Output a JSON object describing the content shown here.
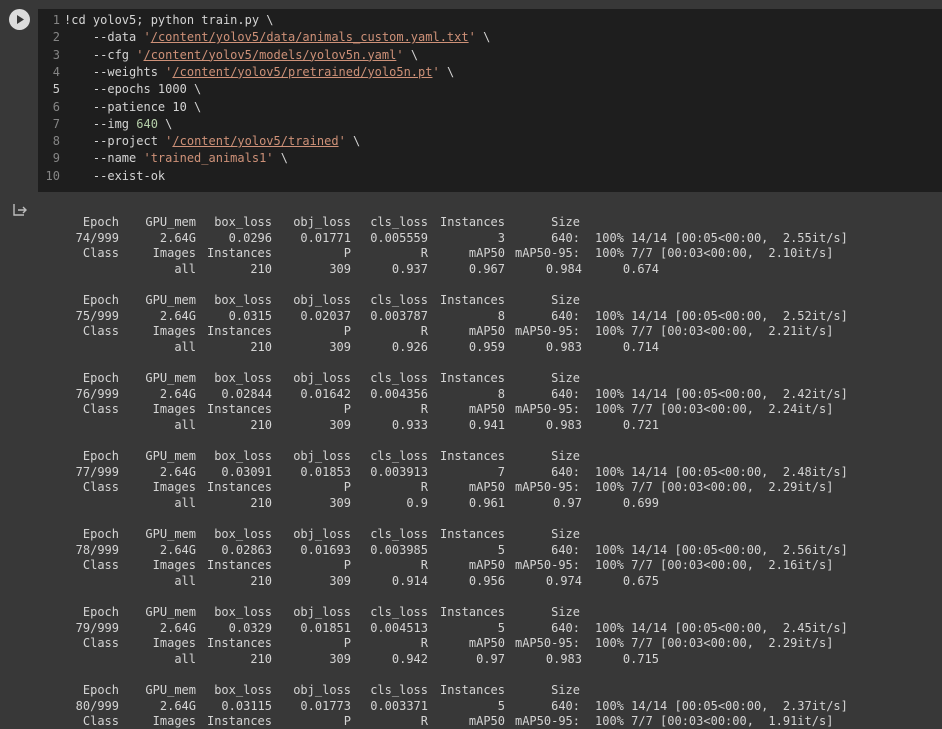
{
  "code_lines": [
    {
      "n": "1",
      "segs": [
        {
          "t": "!cd yolov5; python train.py \\"
        }
      ]
    },
    {
      "n": "2",
      "segs": [
        {
          "t": "    --data "
        },
        {
          "t": "'",
          "c": "str"
        },
        {
          "t": "/content/yolov5/data/animals_custom.yaml.txt",
          "c": "path"
        },
        {
          "t": "'",
          "c": "str"
        },
        {
          "t": " \\"
        }
      ]
    },
    {
      "n": "3",
      "segs": [
        {
          "t": "    --cfg "
        },
        {
          "t": "'",
          "c": "str"
        },
        {
          "t": "/content/yolov5/models/yolov5n.yaml",
          "c": "path"
        },
        {
          "t": "'",
          "c": "str"
        },
        {
          "t": " \\"
        }
      ]
    },
    {
      "n": "4",
      "segs": [
        {
          "t": "    --weights "
        },
        {
          "t": "'",
          "c": "str"
        },
        {
          "t": "/content/yolov5/pretrained/yolo5n.pt",
          "c": "path"
        },
        {
          "t": "'",
          "c": "str"
        },
        {
          "t": " \\"
        }
      ]
    },
    {
      "n": "5",
      "segs": [
        {
          "t": "    --epochs 1000 \\"
        }
      ]
    },
    {
      "n": "6",
      "segs": [
        {
          "t": "    --patience 10 \\"
        }
      ]
    },
    {
      "n": "7",
      "segs": [
        {
          "t": "    --img "
        },
        {
          "t": "640",
          "c": "num"
        },
        {
          "t": " \\"
        }
      ]
    },
    {
      "n": "8",
      "segs": [
        {
          "t": "    --project "
        },
        {
          "t": "'",
          "c": "str"
        },
        {
          "t": "/content/yolov5/trained",
          "c": "path"
        },
        {
          "t": "'",
          "c": "str"
        },
        {
          "t": " \\"
        }
      ]
    },
    {
      "n": "9",
      "segs": [
        {
          "t": "    --name "
        },
        {
          "t": "'trained_animals1'",
          "c": "str"
        },
        {
          "t": " \\"
        }
      ]
    },
    {
      "n": "10",
      "segs": [
        {
          "t": "    --exist-ok"
        }
      ]
    }
  ],
  "current_line": "5",
  "train_headers": [
    "Epoch",
    "GPU_mem",
    "box_loss",
    "obj_loss",
    "cls_loss",
    "Instances",
    "Size"
  ],
  "val_headers": [
    "Class",
    "Images",
    "Instances",
    "P",
    "R",
    "mAP50",
    "mAP50-95:"
  ],
  "epochs": [
    {
      "train": [
        "74/999",
        "2.64G",
        "0.0296",
        "0.01771",
        "0.005559",
        "3",
        "640:"
      ],
      "train_prog": "100% 14/14 [00:05<00:00,  2.55it/s]",
      "val_prog": "100% 7/7 [00:03<00:00,  2.10it/s]",
      "val": [
        "all",
        "210",
        "309",
        "0.937",
        "0.967",
        "0.984",
        "0.674"
      ]
    },
    {
      "train": [
        "75/999",
        "2.64G",
        "0.0315",
        "0.02037",
        "0.003787",
        "8",
        "640:"
      ],
      "train_prog": "100% 14/14 [00:05<00:00,  2.52it/s]",
      "val_prog": "100% 7/7 [00:03<00:00,  2.21it/s]",
      "val": [
        "all",
        "210",
        "309",
        "0.926",
        "0.959",
        "0.983",
        "0.714"
      ]
    },
    {
      "train": [
        "76/999",
        "2.64G",
        "0.02844",
        "0.01642",
        "0.004356",
        "8",
        "640:"
      ],
      "train_prog": "100% 14/14 [00:05<00:00,  2.42it/s]",
      "val_prog": "100% 7/7 [00:03<00:00,  2.24it/s]",
      "val": [
        "all",
        "210",
        "309",
        "0.933",
        "0.941",
        "0.983",
        "0.721"
      ]
    },
    {
      "train": [
        "77/999",
        "2.64G",
        "0.03091",
        "0.01853",
        "0.003913",
        "7",
        "640:"
      ],
      "train_prog": "100% 14/14 [00:05<00:00,  2.48it/s]",
      "val_prog": "100% 7/7 [00:03<00:00,  2.29it/s]",
      "val": [
        "all",
        "210",
        "309",
        "0.9",
        "0.961",
        "0.97",
        "0.699"
      ]
    },
    {
      "train": [
        "78/999",
        "2.64G",
        "0.02863",
        "0.01693",
        "0.003985",
        "5",
        "640:"
      ],
      "train_prog": "100% 14/14 [00:05<00:00,  2.56it/s]",
      "val_prog": "100% 7/7 [00:03<00:00,  2.16it/s]",
      "val": [
        "all",
        "210",
        "309",
        "0.914",
        "0.956",
        "0.974",
        "0.675"
      ]
    },
    {
      "train": [
        "79/999",
        "2.64G",
        "0.0329",
        "0.01851",
        "0.004513",
        "5",
        "640:"
      ],
      "train_prog": "100% 14/14 [00:05<00:00,  2.45it/s]",
      "val_prog": "100% 7/7 [00:03<00:00,  2.29it/s]",
      "val": [
        "all",
        "210",
        "309",
        "0.942",
        "0.97",
        "0.983",
        "0.715"
      ]
    },
    {
      "train": [
        "80/999",
        "2.64G",
        "0.03115",
        "0.01773",
        "0.003371",
        "5",
        "640:"
      ],
      "train_prog": "100% 14/14 [00:05<00:00,  2.37it/s]",
      "val_prog": "100% 7/7 [00:03<00:00,  1.91it/s]",
      "val": []
    }
  ],
  "icons": {
    "run": "play-icon",
    "output": "output-icon"
  },
  "colors": {
    "editor_bg": "#1e1e1e",
    "output_bg": "#383838",
    "string": "#ce9178",
    "number": "#b5cea8",
    "text": "#d4d4d4"
  }
}
